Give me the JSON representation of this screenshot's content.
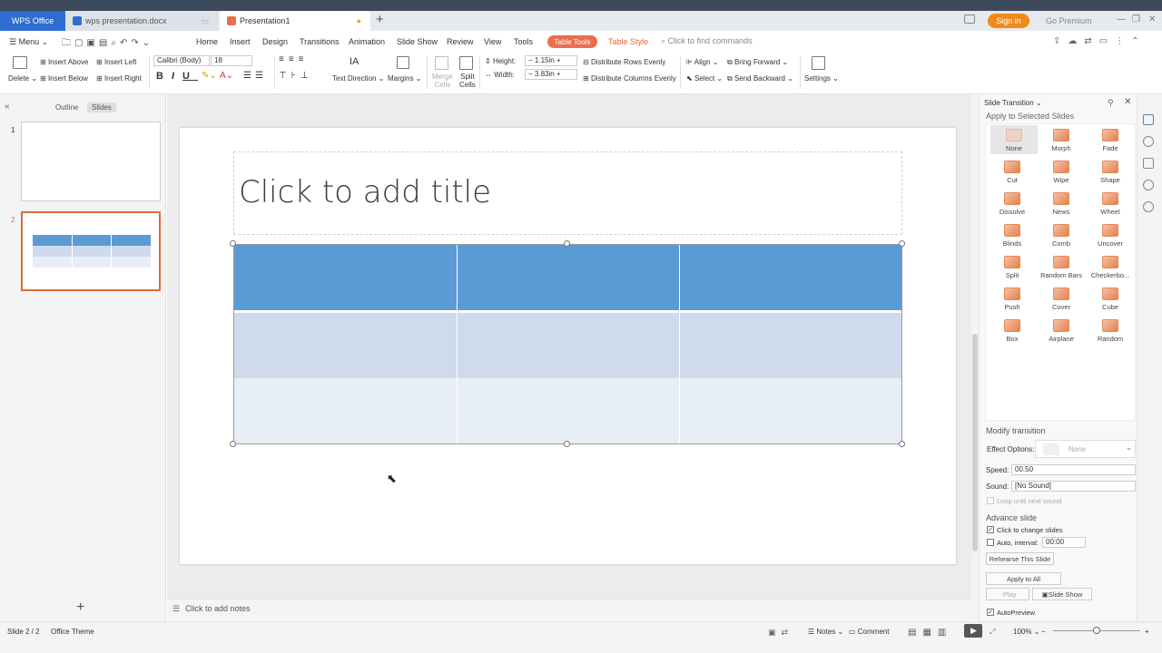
{
  "tabs": {
    "wps_office": "WPS Office",
    "document": "wps presentation.docx",
    "presentation": "Presentation1"
  },
  "titlebar": {
    "sign_in": "Sign in",
    "go_premium": "Go Premium"
  },
  "menu": {
    "menu_label": "Menu",
    "items": [
      "Home",
      "Insert",
      "Design",
      "Transitions",
      "Animation",
      "Slide Show",
      "Review",
      "View",
      "Tools"
    ],
    "table_tools": "Table Tools",
    "table_style": "Table Style",
    "find_commands": "Click to find commands"
  },
  "ribbon": {
    "delete": "Delete",
    "insert_above": "Insert Above",
    "insert_below": "Insert Below",
    "insert_left": "Insert Left",
    "insert_right": "Insert Right",
    "font": "Calibri (Body)",
    "font_size": "18",
    "text_direction": "Text Direction",
    "margins": "Margins",
    "merge_cells_1": "Merge",
    "merge_cells_2": "Cells",
    "split_cells_1": "Split",
    "split_cells_2": "Cells",
    "height_label": "Height:",
    "height_value": "1.15in",
    "width_label": "Width:",
    "width_value": "3.83in",
    "distribute_rows": "Distribute Rows Evenly",
    "distribute_columns": "Distribute Columns Evenly",
    "align": "Align",
    "select": "Select",
    "bring_forward": "Bring Forward",
    "send_backward": "Send Backward",
    "settings": "Settings"
  },
  "left_panel": {
    "outline_tab": "Outline",
    "slides_tab": "Slides",
    "slide_numbers": [
      "1",
      "2"
    ]
  },
  "slide": {
    "title_placeholder": "Click to add title"
  },
  "notes": {
    "placeholder": "Click to add notes"
  },
  "transition_pane": {
    "header": "Slide Transition",
    "apply_selected": "Apply to Selected Slides",
    "transitions": [
      "None",
      "Morph",
      "Fade",
      "Cut",
      "Wipe",
      "Shape",
      "Dissolve",
      "News",
      "Wheel",
      "Blinds",
      "Comb",
      "Uncover",
      "Split",
      "Random Bars",
      "Checkerbo...",
      "Push",
      "Cover",
      "Cube",
      "Box",
      "Airplane",
      "Random"
    ],
    "modify_transition": "Modify transition",
    "effect_options_label": "Effect Options:",
    "effect_options_value": "None",
    "speed_label": "Speed:",
    "speed_value": "00.50",
    "sound_label": "Sound:",
    "sound_value": "[No Sound]",
    "loop_label": "Loop until next sound",
    "advance_slide": "Advance slide",
    "click_to_change": "Click to change slides",
    "auto_interval_label": "Auto, interval:",
    "auto_interval_value": "00:00",
    "rehearse": "Rehearse This Slide",
    "apply_all": "Apply to All",
    "play": "Play",
    "slide_show": "Slide Show",
    "autopreview": "AutoPreview"
  },
  "status": {
    "slide_count": "Slide 2 / 2",
    "theme": "Office Theme",
    "notes": "Notes",
    "comment": "Comment",
    "zoom": "100%"
  },
  "colors": {
    "accent": "#e96f4d",
    "table_header": "#5b9bd5",
    "table_band1": "#cfdbec",
    "table_band2": "#e8eef6"
  }
}
